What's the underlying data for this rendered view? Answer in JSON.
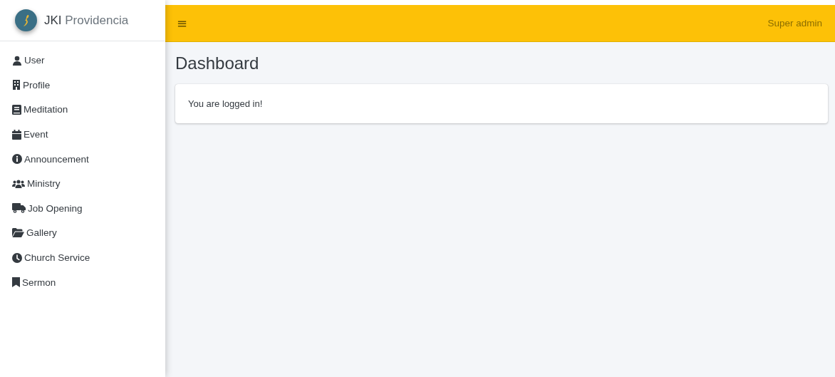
{
  "brand": {
    "text": "**JKI** Providencia"
  },
  "sidebar": {
    "items": [
      {
        "label": "User"
      },
      {
        "label": "Profile"
      },
      {
        "label": "Meditation"
      },
      {
        "label": "Event"
      },
      {
        "label": "Announcement"
      },
      {
        "label": "Ministry"
      },
      {
        "label": "Job Opening"
      },
      {
        "label": "Gallery"
      },
      {
        "label": "Church Service"
      },
      {
        "label": "Sermon"
      }
    ]
  },
  "navbar": {
    "menu_icon": "≡",
    "user": "Super admin"
  },
  "page": {
    "title": "Dashboard",
    "card_text": "You are logged in!"
  }
}
